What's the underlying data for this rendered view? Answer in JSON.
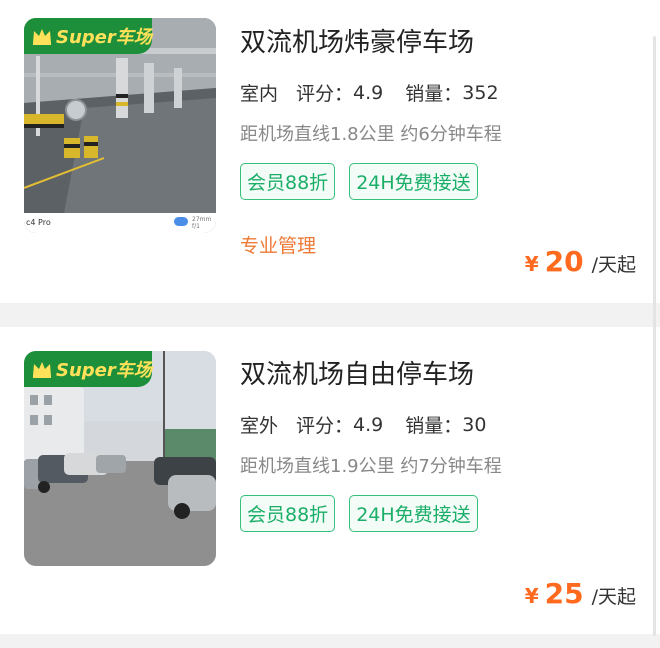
{
  "listings": [
    {
      "badge": "Super车场",
      "image_strip_text": "c4 Pro",
      "image_strip_meta": "27mm f/1",
      "title": "双流机场炜豪停车场",
      "type": "室内",
      "rating_label": "评分：",
      "rating": "4.9",
      "sales_label": "销量：",
      "sales": "352",
      "distance": "距机场直线1.8公里 约6分钟车程",
      "tags": [
        "会员88折",
        "24H免费接送"
      ],
      "extra": "专业管理",
      "currency": "¥",
      "price": "20",
      "price_unit": "/天起"
    },
    {
      "badge": "Super车场",
      "title": "双流机场自由停车场",
      "type": "室外",
      "rating_label": "评分：",
      "rating": "4.9",
      "sales_label": "销量：",
      "sales": "30",
      "distance": "距机场直线1.9公里 约7分钟车程",
      "tags": [
        "会员88折",
        "24H免费接送"
      ],
      "currency": "¥",
      "price": "25",
      "price_unit": "/天起"
    }
  ],
  "colors": {
    "accent_green": "#1aae68",
    "badge_green": "#1d8f3a",
    "badge_text": "#ffe15a",
    "price_orange": "#ff6a1f",
    "extra_orange": "#ee7a35"
  }
}
